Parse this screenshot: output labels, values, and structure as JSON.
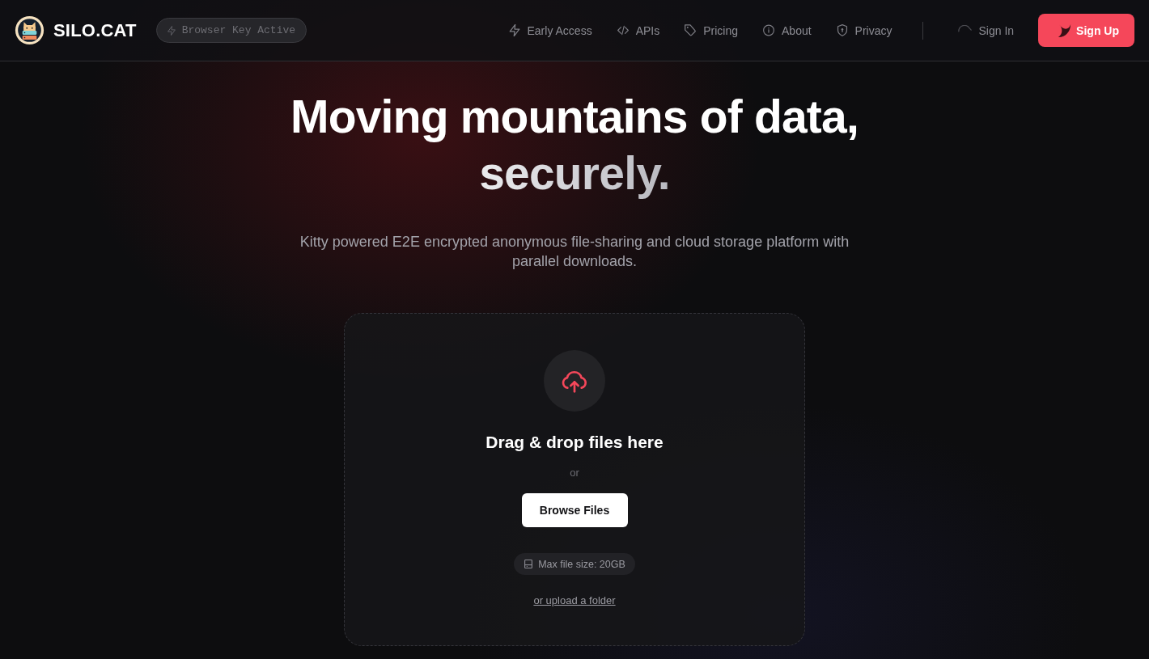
{
  "header": {
    "brand": "SILO.CAT",
    "badge": "Browser Key Active",
    "nav": [
      {
        "label": "Early Access"
      },
      {
        "label": "APIs"
      },
      {
        "label": "Pricing"
      },
      {
        "label": "About"
      },
      {
        "label": "Privacy"
      }
    ],
    "sign_in": "Sign In",
    "sign_up": "Sign Up"
  },
  "hero": {
    "title": "Moving mountains of data,",
    "title_accent": "securely.",
    "subtitle": "Kitty powered E2E encrypted anonymous file-sharing and cloud storage platform with parallel downloads."
  },
  "upload": {
    "heading": "Drag & drop files here",
    "separator": "or",
    "button": "Browse Files",
    "limit": "Max file size: 20GB",
    "folder_link": "or upload a folder"
  }
}
